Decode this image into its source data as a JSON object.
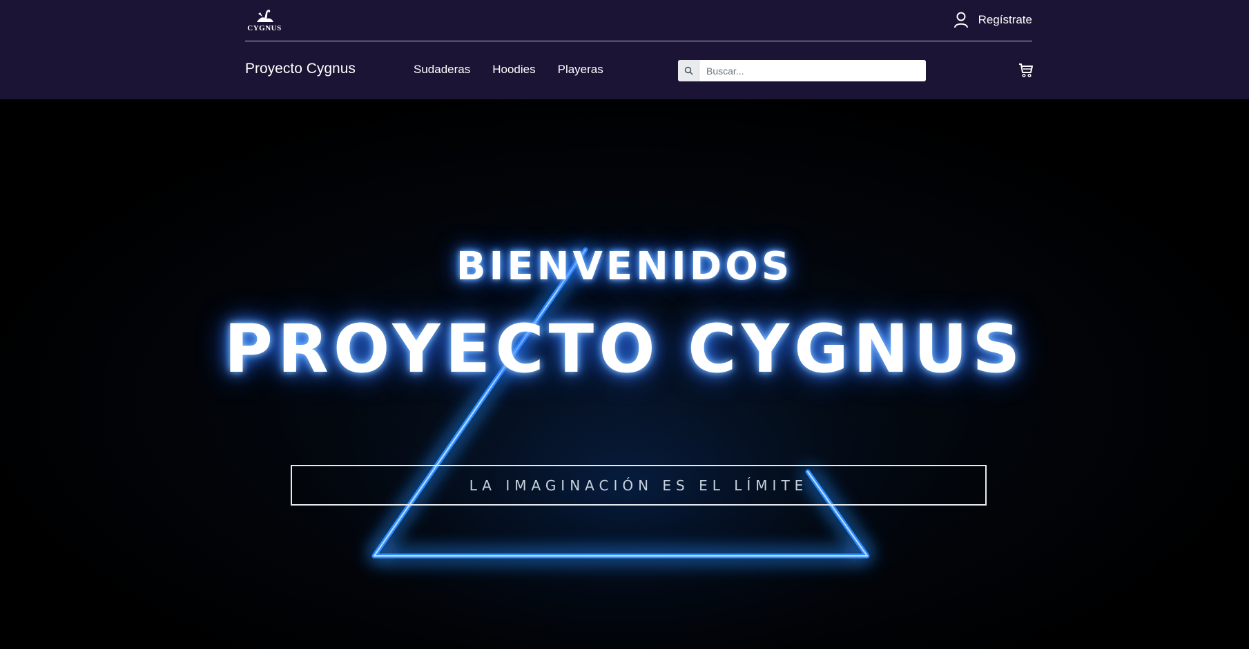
{
  "header": {
    "logo_text": "CYGNUS",
    "register_label": "Regístrate",
    "brand": "Proyecto Cygnus",
    "nav": [
      "Sudaderas",
      "Hoodies",
      "Playeras"
    ],
    "search": {
      "placeholder": "Buscar..."
    },
    "icons": {
      "user": "user-icon",
      "search": "search-icon",
      "cart": "cart-icon",
      "logo": "swan-logo-icon"
    }
  },
  "hero": {
    "welcome": "BIENVENIDOS",
    "headline": "PROYECTO CYGNUS",
    "tagline": "LA IMAGINACIÓN ES EL LÍMITE"
  },
  "colors": {
    "header_bg": "#1b1435",
    "hero_bg": "#000000",
    "neon_blue": "#1f8cff",
    "text": "#ffffff"
  }
}
